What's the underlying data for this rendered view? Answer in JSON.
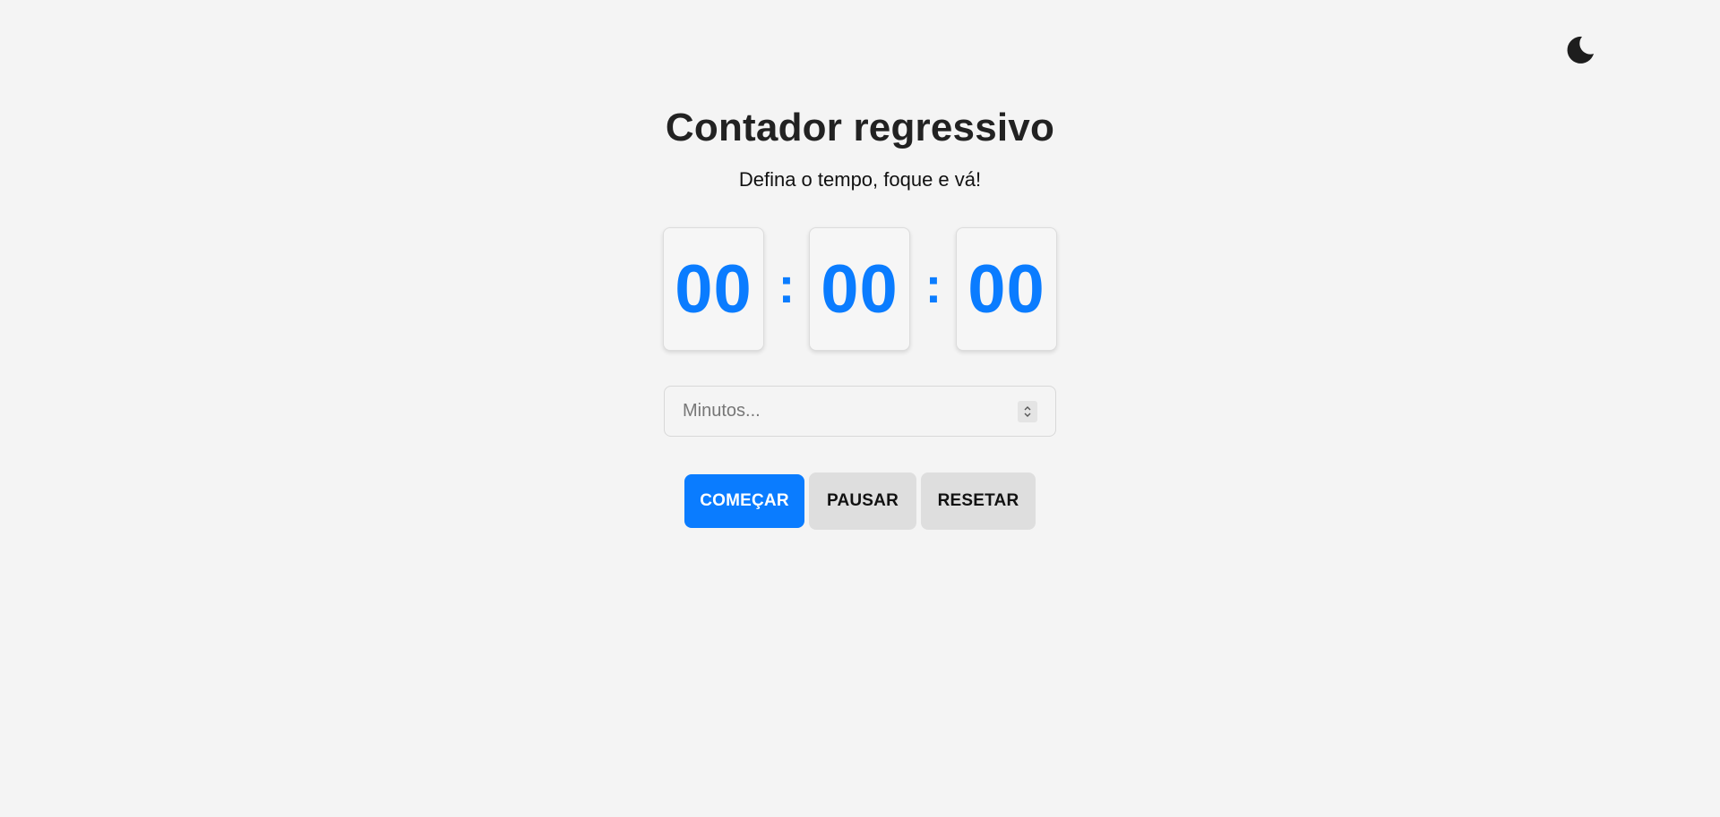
{
  "header": {
    "theme_toggle_icon": "moon-icon"
  },
  "main": {
    "title": "Contador regressivo",
    "subtitle": "Defina o tempo, foque e vá!"
  },
  "timer": {
    "hours": "00",
    "minutes": "00",
    "seconds": "00",
    "separator": ":",
    "digit_color": "#0a7cff"
  },
  "input": {
    "placeholder": "Minutos...",
    "value": ""
  },
  "controls": {
    "start_label": "COMEÇAR",
    "pause_label": "PAUSAR",
    "reset_label": "RESETAR",
    "accent_color": "#0a7cff"
  }
}
